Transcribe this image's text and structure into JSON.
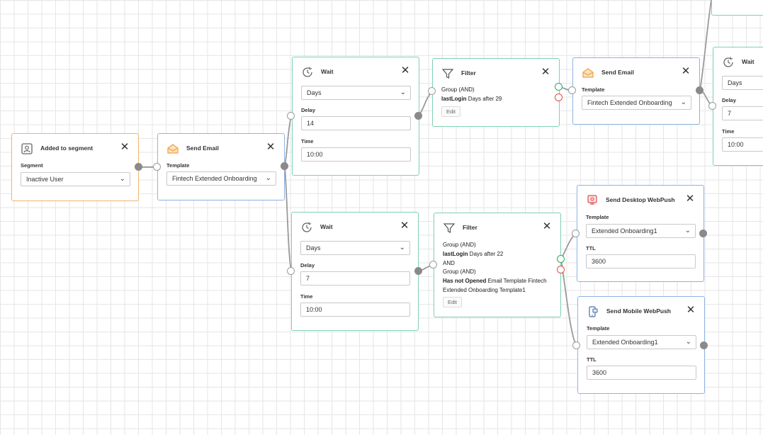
{
  "colors": {
    "trigger_border": "#f0b46a",
    "email_border": "#8fb3e3",
    "logic_border": "#7fd1b0",
    "port_yes": "#2ea866",
    "port_no": "#e04a4a",
    "connector": "#9a9a9a"
  },
  "icons": {
    "trigger": "user-segment-icon",
    "email": "envelope-open-icon",
    "wait": "clock-icon",
    "filter": "funnel-icon",
    "desktop_push": "desktop-push-icon",
    "mobile_push": "mobile-push-icon",
    "close": "close-icon",
    "dropdown": "chevron-down-icon"
  },
  "trigger": {
    "title": "Added to segment",
    "segment_label": "Segment",
    "segment_value": "Inactive User"
  },
  "send_email_1": {
    "title": "Send Email",
    "template_label": "Template",
    "template_value": "Fintech Extended Onboarding"
  },
  "wait_top": {
    "title": "Wait",
    "unit": "Days",
    "delay_label": "Delay",
    "delay_value": "14",
    "time_label": "Time",
    "time_value": "10:00"
  },
  "filter_top": {
    "title": "Filter",
    "line1": "Group (AND)",
    "line2_field": "lastLogin",
    "line2_rest": " Days after 29",
    "edit_label": "Edit"
  },
  "send_email_2": {
    "title": "Send Email",
    "template_label": "Template",
    "template_value": "Fintech Extended Onboarding"
  },
  "wait_far": {
    "title": "Wait",
    "unit": "Days",
    "delay_label": "Delay",
    "delay_value": "7",
    "time_label": "Time",
    "time_value": "10:00"
  },
  "wait_bottom": {
    "title": "Wait",
    "unit": "Days",
    "delay_label": "Delay",
    "delay_value": "7",
    "time_label": "Time",
    "time_value": "10:00"
  },
  "filter_bottom": {
    "title": "Filter",
    "line1": "Group (AND)",
    "line2_field": "lastLogin",
    "line2_rest": " Days after 22",
    "line3": "AND",
    "line4": "Group (AND)",
    "line5_field": "Has not Opened",
    "line5_rest": " Email Template Fintech",
    "line6": "Extended Onboarding Template1",
    "edit_label": "Edit"
  },
  "desktop_push": {
    "title": "Send Desktop WebPush",
    "template_label": "Template",
    "template_value": "Extended Onboarding1",
    "ttl_label": "TTL",
    "ttl_value": "3600"
  },
  "mobile_push": {
    "title": "Send Mobile WebPush",
    "template_label": "Template",
    "template_value": "Extended Onboarding1",
    "ttl_label": "TTL",
    "ttl_value": "3600"
  }
}
